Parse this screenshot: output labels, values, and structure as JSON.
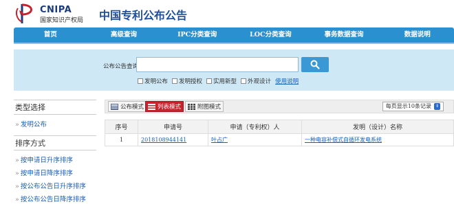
{
  "header": {
    "logo_en": "CNIPA",
    "logo_cn": "国家知识产权局",
    "site_title": "中国专利公布公告"
  },
  "nav": {
    "items": [
      {
        "label": "首页"
      },
      {
        "label": "高级查询"
      },
      {
        "label": "IPC分类查询"
      },
      {
        "label": "LOC分类查询"
      },
      {
        "label": "事务数据查询"
      },
      {
        "label": "数据说明"
      }
    ]
  },
  "search": {
    "label": "公布公告查询",
    "value": "",
    "placeholder": "",
    "options": [
      {
        "label": "发明公布",
        "checked": false
      },
      {
        "label": "发明授权",
        "checked": false
      },
      {
        "label": "实用新型",
        "checked": false
      },
      {
        "label": "外观设计",
        "checked": false
      }
    ],
    "help_link": "使用说明"
  },
  "sidebar": {
    "type_heading": "类型选择",
    "type_items": [
      {
        "label": "发明公布"
      }
    ],
    "sort_heading": "排序方式",
    "sort_items": [
      {
        "label": "按申请日升序排序"
      },
      {
        "label": "按申请日降序排序"
      },
      {
        "label": "按公布公告日升序排序"
      },
      {
        "label": "按公布公告日降序排序"
      }
    ],
    "arrow": "»"
  },
  "viewbar": {
    "modes": [
      {
        "label": "公布模式",
        "active": false
      },
      {
        "label": "列表模式",
        "active": true
      },
      {
        "label": "附图模式",
        "active": false
      }
    ],
    "per_page": "每页显示10条记录"
  },
  "table": {
    "headers": [
      "序号",
      "申请号",
      "申请（专利权）人",
      "发明（设计）名称"
    ],
    "rows": [
      {
        "num": "1",
        "app_no": "2018108944141",
        "applicant": "叶占广",
        "title": "一种电容补偿式自循环发电系统"
      }
    ]
  },
  "colors": {
    "nav_bg": "#2a90cf",
    "search_bg": "#cfe8f6",
    "active_mode": "#c8232c",
    "link": "#1a5fb4",
    "title": "#1f4f9f"
  }
}
